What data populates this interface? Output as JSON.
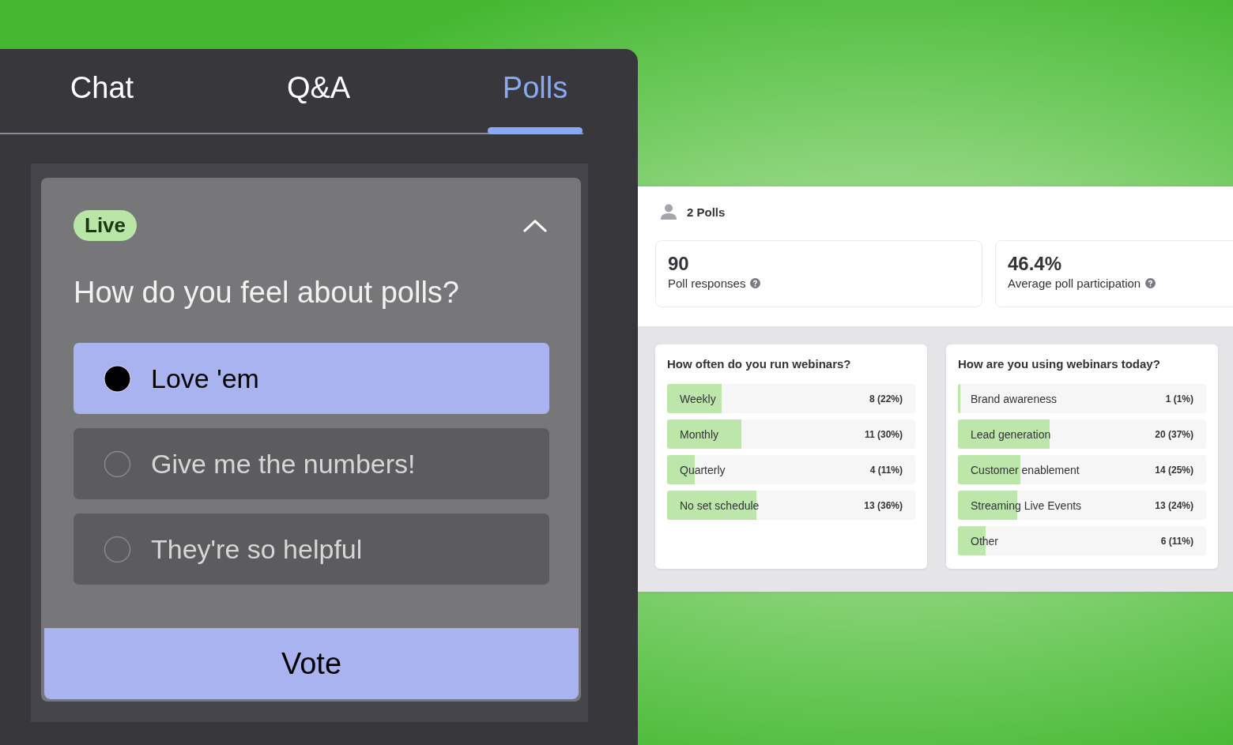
{
  "side_panel": {
    "tabs": [
      {
        "label": "Chat",
        "selected": false
      },
      {
        "label": "Q&A",
        "selected": false
      },
      {
        "label": "Polls",
        "selected": true
      }
    ],
    "poll": {
      "status": "Live",
      "expanded": true,
      "question": "How do you feel about polls?",
      "options": [
        {
          "label": "Love 'em",
          "selected": true
        },
        {
          "label": "Give me the numbers!",
          "selected": false
        },
        {
          "label": "They're so helpful",
          "selected": false
        }
      ],
      "vote_button": "Vote"
    }
  },
  "dashboard": {
    "title": "2 Polls",
    "stats": [
      {
        "value": "90",
        "label": "Poll responses"
      },
      {
        "value": "46.4%",
        "label": "Average poll participation"
      }
    ],
    "polls": [
      {
        "question": "How often do you run webinars?",
        "results": [
          {
            "label": "Weekly",
            "reading": "8 (22%)",
            "level": 0.22
          },
          {
            "label": "Monthly",
            "reading": "11 (30%)",
            "level": 0.3
          },
          {
            "label": "Quarterly",
            "reading": "4 (11%)",
            "level": 0.11
          },
          {
            "label": "No set schedule",
            "reading": "13 (36%)",
            "level": 0.36
          }
        ]
      },
      {
        "question": "How are you using webinars today?",
        "results": [
          {
            "label": "Brand awareness",
            "reading": "1 (1%)",
            "level": 0.01
          },
          {
            "label": "Lead generation",
            "reading": "20 (37%)",
            "level": 0.37
          },
          {
            "label": "Customer enablement",
            "reading": "14 (25%)",
            "level": 0.25
          },
          {
            "label": "Streaming Live Events",
            "reading": "13 (24%)",
            "level": 0.24
          },
          {
            "label": "Other",
            "reading": "6 (11%)",
            "level": 0.11
          }
        ]
      }
    ]
  }
}
